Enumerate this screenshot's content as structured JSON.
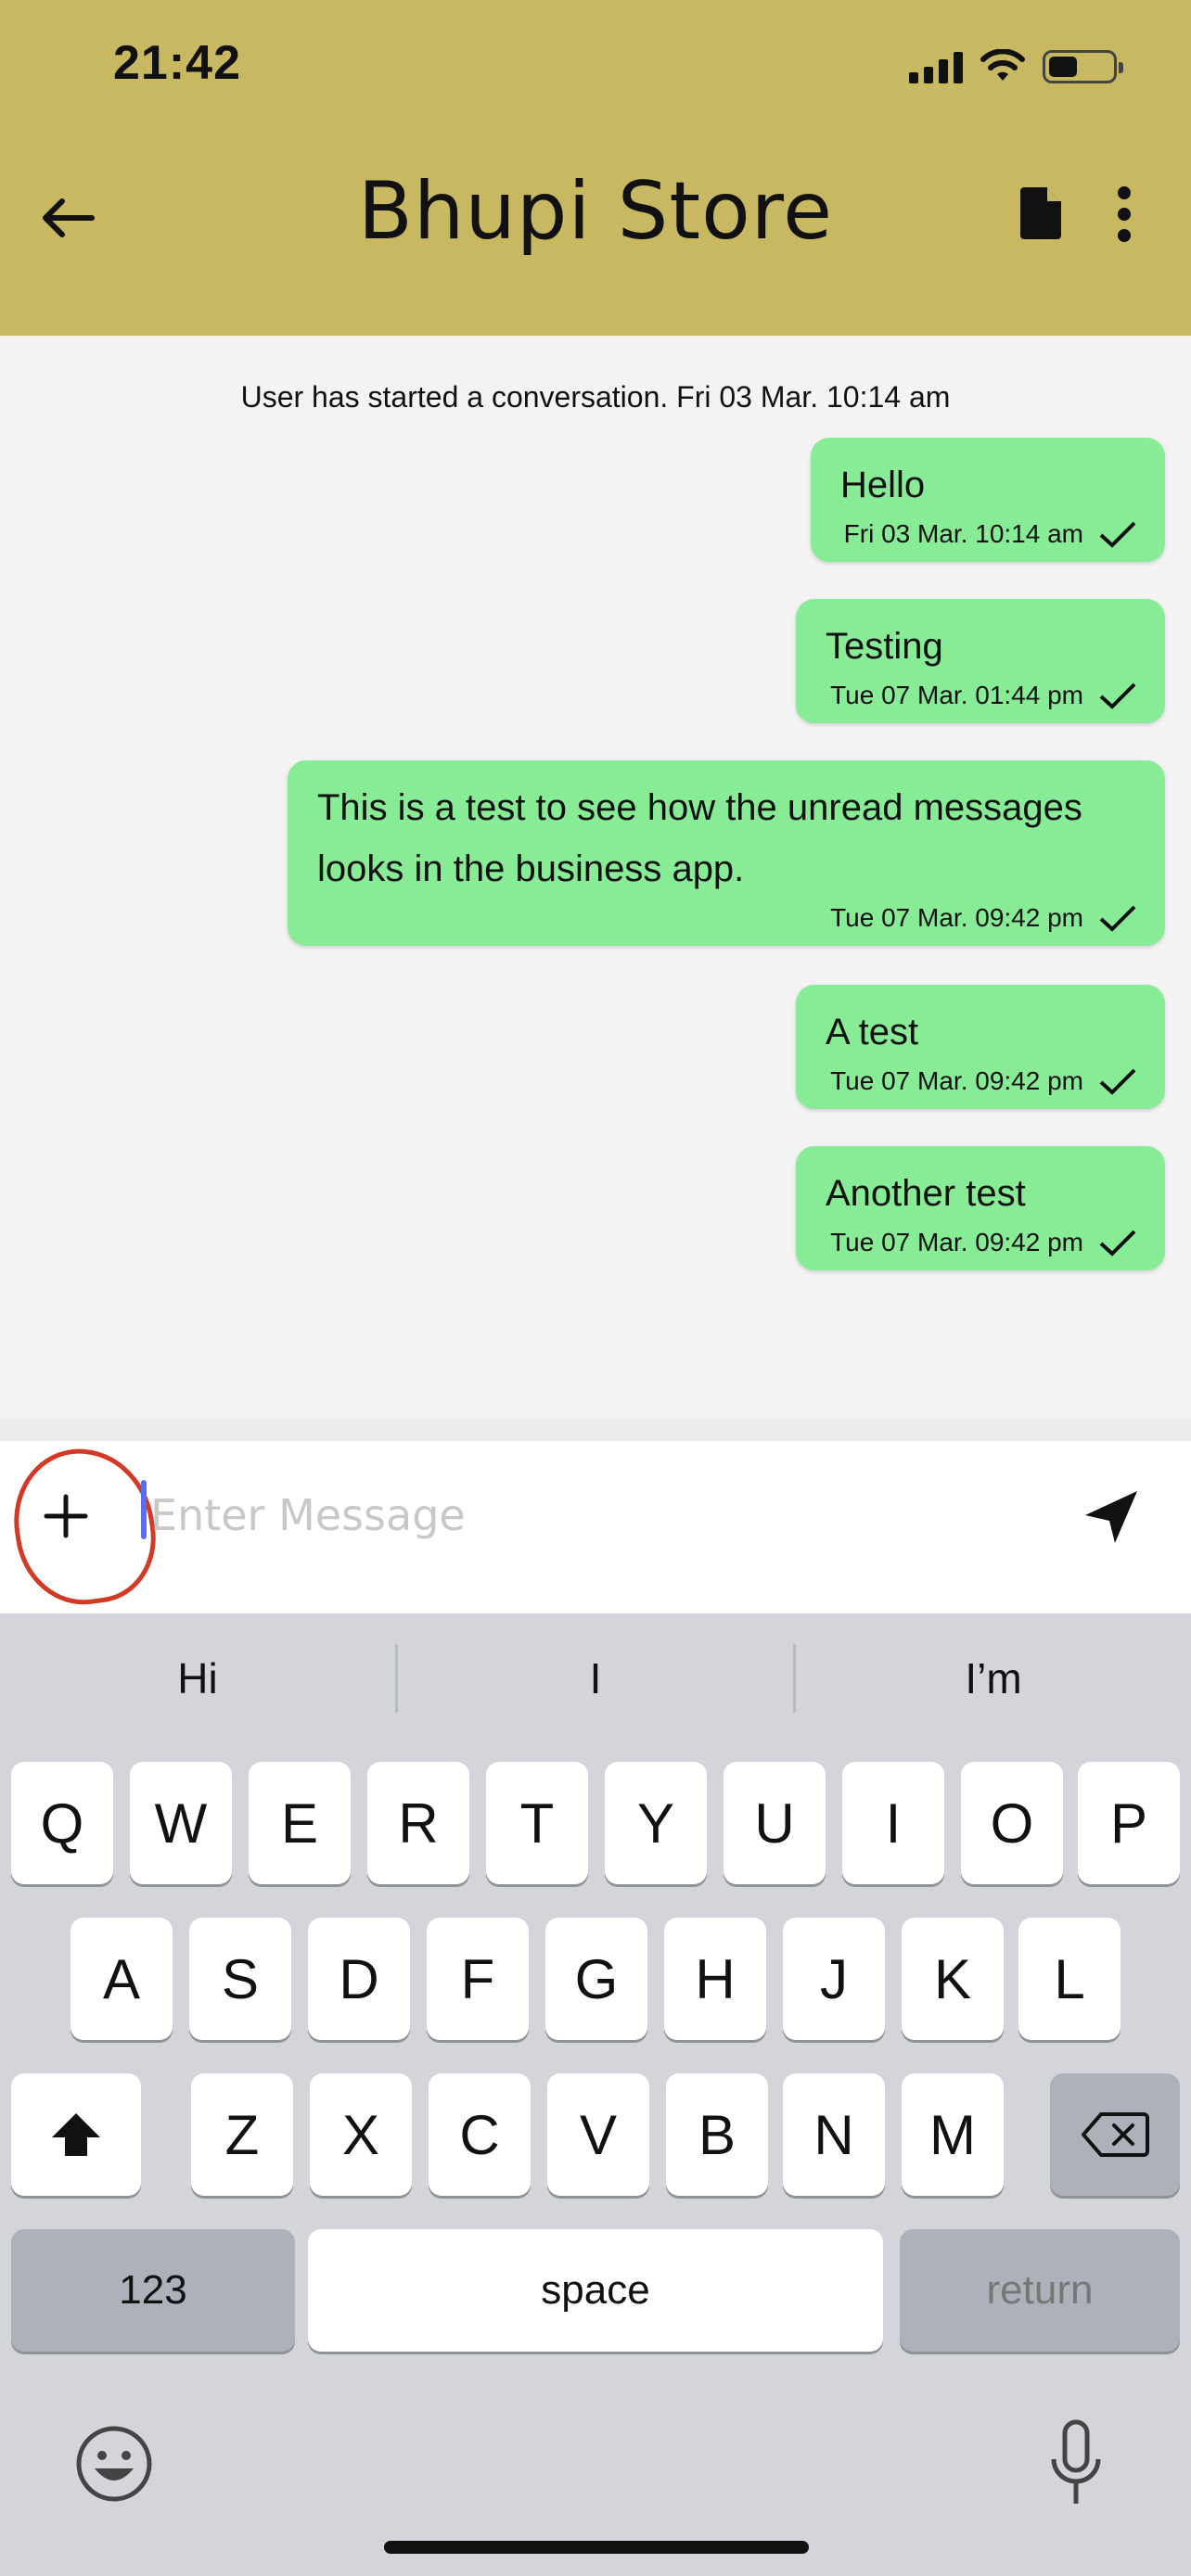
{
  "status_bar": {
    "time": "21:42"
  },
  "header": {
    "title": "Bhupi Store",
    "background": "#c8b862"
  },
  "chat": {
    "system_message": "User has started a conversation. Fri 03 Mar. 10:14 am",
    "messages": [
      {
        "text": "Hello",
        "time": "Fri 03 Mar. 10:14 am"
      },
      {
        "text": "Testing",
        "time": "Tue 07 Mar. 01:44 pm"
      },
      {
        "text": "This is a test to see how the unread messages looks in the business app.",
        "time": "Tue 07 Mar. 09:42 pm"
      },
      {
        "text": "A test",
        "time": "Tue 07 Mar. 09:42 pm"
      },
      {
        "text": "Another test",
        "time": "Tue 07 Mar. 09:42 pm"
      }
    ],
    "bubble_color": "#88ec96"
  },
  "composer": {
    "placeholder": "Enter Message"
  },
  "keyboard": {
    "suggestions": [
      "Hi",
      "I",
      "I’m"
    ],
    "row1": [
      "Q",
      "W",
      "E",
      "R",
      "T",
      "Y",
      "U",
      "I",
      "O",
      "P"
    ],
    "row2": [
      "A",
      "S",
      "D",
      "F",
      "G",
      "H",
      "J",
      "K",
      "L"
    ],
    "row3": [
      "Z",
      "X",
      "C",
      "V",
      "B",
      "N",
      "M"
    ],
    "numbers_label": "123",
    "space_label": "space",
    "return_label": "return"
  }
}
